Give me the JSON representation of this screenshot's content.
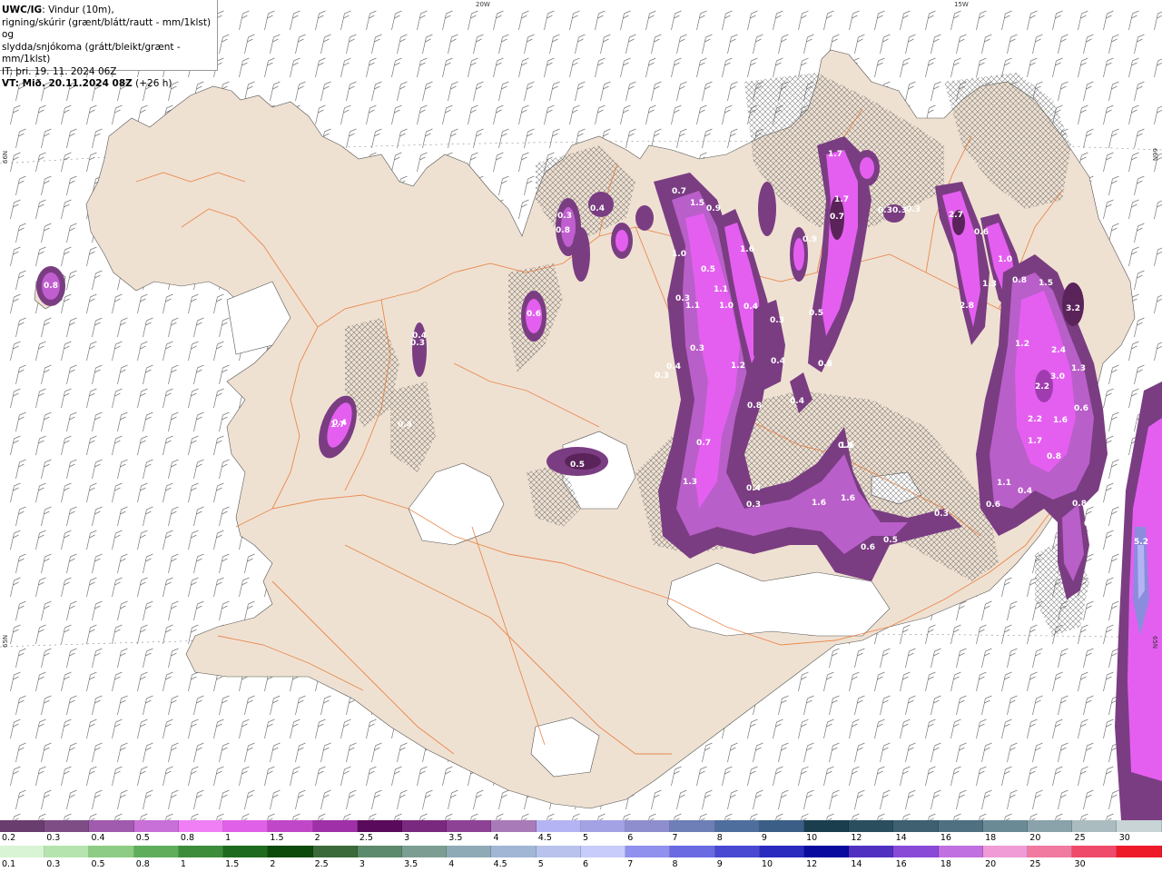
{
  "info": {
    "model": "UWC/IG",
    "line1_rest": ": Vindur (10m),",
    "line2": "rigning/skúrir (grænt/blátt/rautt - mm/1klst) og",
    "line3": "slydda/snjókoma (grátt/bleikt/grænt - mm/1klst)",
    "line4": "IT: þri. 19. 11. 2024 06Z",
    "vt_label": "VT: Mið. 20.11.2024 08Z",
    "vt_rest": " (+26 h)"
  },
  "grid_labels": {
    "lon_20w": "20W",
    "lon_15w": "15W",
    "lat_66n_left": "66N",
    "lat_66n_right": "66N",
    "lat_65n_left": "65N",
    "lat_65n_right": "65N"
  },
  "colors": {
    "land": "#efe1d2",
    "sea": "#ffffff",
    "roads": "#e8722e",
    "precip_light": "#b95fc9",
    "precip_mid": "#e45ff0",
    "precip_dark": "#7a3d82",
    "precip_darkest": "#5a235a"
  },
  "precip_values": [
    {
      "v": "0.8"
    },
    {
      "v": "0.4"
    },
    {
      "v": "1.7"
    },
    {
      "v": "0.4"
    },
    {
      "v": "0.4"
    },
    {
      "v": "0.3"
    },
    {
      "v": "0.6"
    },
    {
      "v": "0.5"
    },
    {
      "v": "0.3"
    },
    {
      "v": "0.8"
    },
    {
      "v": "0.4"
    },
    {
      "v": "0.7"
    },
    {
      "v": "1.5"
    },
    {
      "v": "0.9"
    },
    {
      "v": "1.0"
    },
    {
      "v": "0.5"
    },
    {
      "v": "1.6"
    },
    {
      "v": "1.1"
    },
    {
      "v": "0.3"
    },
    {
      "v": "1.1"
    },
    {
      "v": "1.0"
    },
    {
      "v": "0.4"
    },
    {
      "v": "0.3"
    },
    {
      "v": "0.4"
    },
    {
      "v": "1.2"
    },
    {
      "v": "0.3"
    },
    {
      "v": "0.8"
    },
    {
      "v": "0.7"
    },
    {
      "v": "0.4"
    },
    {
      "v": "1.3"
    },
    {
      "v": "0.4"
    },
    {
      "v": "0.3"
    },
    {
      "v": "1.6"
    },
    {
      "v": "1.6"
    },
    {
      "v": "0.6"
    },
    {
      "v": "0.5"
    },
    {
      "v": "0.3"
    },
    {
      "v": "1.6"
    },
    {
      "v": "0.6"
    },
    {
      "v": "1.7"
    },
    {
      "v": "1.7"
    },
    {
      "v": "0.7"
    },
    {
      "v": "0.9"
    },
    {
      "v": "0.5"
    },
    {
      "v": "0.3"
    },
    {
      "v": "0.3"
    },
    {
      "v": "0.4"
    },
    {
      "v": "2.7"
    },
    {
      "v": "0.6"
    },
    {
      "v": "1.0"
    },
    {
      "v": "1.3"
    },
    {
      "v": "0.8"
    },
    {
      "v": "1.5"
    },
    {
      "v": "2.8"
    },
    {
      "v": "3.2"
    },
    {
      "v": "1.2"
    },
    {
      "v": "2.4"
    },
    {
      "v": "3.0"
    },
    {
      "v": "1.3"
    },
    {
      "v": "2.2"
    },
    {
      "v": "2.2"
    },
    {
      "v": "1.6"
    },
    {
      "v": "0.6"
    },
    {
      "v": "1.7"
    },
    {
      "v": "0.8"
    },
    {
      "v": "1.1"
    },
    {
      "v": "0.4"
    },
    {
      "v": "0.6"
    },
    {
      "v": "0.8"
    },
    {
      "v": "0.6"
    },
    {
      "v": "5.2"
    },
    {
      "v": "0.5"
    },
    {
      "v": "0.3"
    },
    {
      "v": "0.8"
    },
    {
      "v": "0.3"
    }
  ],
  "scale_top": {
    "labels": [
      "0.2",
      "0.3",
      "0.4",
      "0.5",
      "0.8",
      "1",
      "1.5",
      "2",
      "2.5",
      "3",
      "3.5",
      "4",
      "4.5",
      "5",
      "6",
      "7",
      "8",
      "9",
      "10",
      "12",
      "14",
      "16",
      "18",
      "20",
      "25",
      "30"
    ],
    "colors": [
      "#6a3d6f",
      "#7e4d86",
      "#a05aae",
      "#c86fd8",
      "#f07ff5",
      "#e060e8",
      "#c048c8",
      "#a030a8",
      "#5a0a5a",
      "#7a2a7e",
      "#8e4296",
      "#a87ab8",
      "#b4b4f4",
      "#a2a2e4",
      "#8e8ece",
      "#6e7eb6",
      "#4e6e9e",
      "#3a5e86",
      "#1a3e4e",
      "#2a4e5e",
      "#3e6070",
      "#4e7080",
      "#6a8a96",
      "#8aa2aa",
      "#aabcc0",
      "#c8d4d6"
    ]
  },
  "scale_bottom": {
    "labels": [
      "0.1",
      "0.3",
      "0.5",
      "0.8",
      "1",
      "1.5",
      "2",
      "2.5",
      "3",
      "3.5",
      "4",
      "4.5",
      "5",
      "6",
      "7",
      "8",
      "9",
      "10",
      "12",
      "14",
      "16",
      "18",
      "20",
      "25",
      "30"
    ],
    "colors": [
      "#d8f4d4",
      "#b6e4ae",
      "#8ccc84",
      "#60ae5c",
      "#3c8c3c",
      "#1e6a1e",
      "#0c4a0c",
      "#3a6a3a",
      "#5c8a6c",
      "#7c9e92",
      "#8eaab6",
      "#a0b6d4",
      "#b8c2ec",
      "#c8ccfa",
      "#9090ee",
      "#6a6ae2",
      "#4848d2",
      "#2a2abe",
      "#0a0a9e",
      "#5030c0",
      "#8a4ad8",
      "#c070e0",
      "#f09ad6",
      "#f07aa0",
      "#f04a6a",
      "#ee1a2a"
    ]
  }
}
